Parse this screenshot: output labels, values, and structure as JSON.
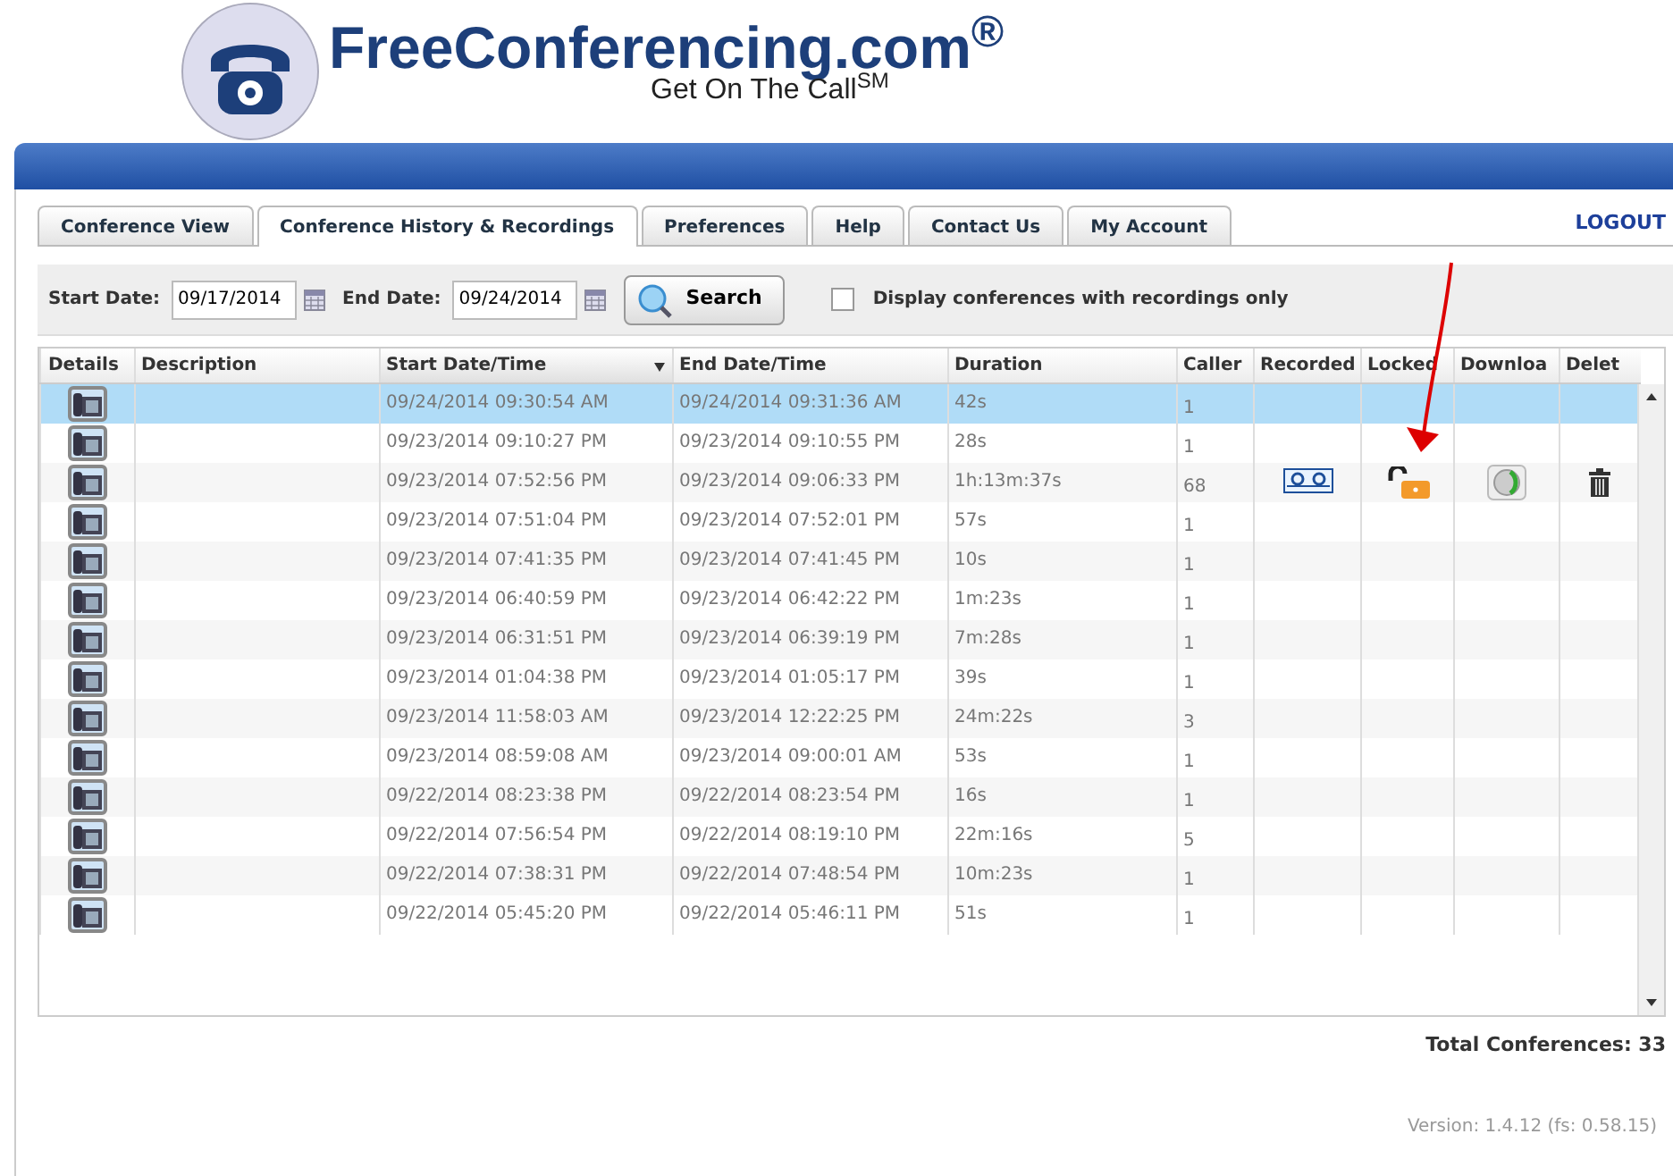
{
  "brand": {
    "name": "FreeConferencing.com$^{®}$",
    "tagline": "Get On The Call$^{SM}$"
  },
  "tabs": [
    {
      "label": "Conference View",
      "selected": false
    },
    {
      "label": "Conference History & Recordings",
      "selected": true
    },
    {
      "label": "Preferences",
      "selected": false
    },
    {
      "label": "Help",
      "selected": false
    },
    {
      "label": "Contact Us",
      "selected": false
    },
    {
      "label": "My Account",
      "selected": false
    }
  ],
  "logout": "LOGOUT",
  "filter": {
    "start_label": "Start Date:",
    "start_value": "09/17/2014",
    "end_label": "End Date:",
    "end_value": "09/24/2014",
    "search_button": "Search",
    "recordings_only": {
      "label": "Display conferences with recordings only",
      "checked": false
    }
  },
  "table": {
    "columns": [
      {
        "label": "Details",
        "sorted": false
      },
      {
        "label": "Description",
        "sorted": false
      },
      {
        "label": "Start Date/Time",
        "sorted": true
      },
      {
        "label": "End Date/Time",
        "sorted": false
      },
      {
        "label": "Duration",
        "sorted": false
      },
      {
        "label": "Caller",
        "sorted": false
      },
      {
        "label": "Recorded",
        "sorted": false
      },
      {
        "label": "Locked",
        "sorted": false
      },
      {
        "label": "Downloa",
        "sorted": false
      },
      {
        "label": "Delet",
        "sorted": false
      }
    ],
    "rows": [
      {
        "selected": true,
        "start": "09/24/2014 09:30:54 AM",
        "end": "09/24/2014 09:31:36 AM",
        "duration": "42s",
        "callers": "1",
        "recording": null
      },
      {
        "selected": false,
        "start": "09/23/2014 09:10:27 PM",
        "end": "09/23/2014 09:10:55 PM",
        "duration": "28s",
        "callers": "1",
        "recording": null
      },
      {
        "selected": false,
        "start": "09/23/2014 07:52:56 PM",
        "end": "09/23/2014 09:06:33 PM",
        "duration": "1h:13m:37s",
        "callers": "68",
        "recording": {
          "locked": false
        }
      },
      {
        "selected": false,
        "start": "09/23/2014 07:51:04 PM",
        "end": "09/23/2014 07:52:01 PM",
        "duration": "57s",
        "callers": "1",
        "recording": null
      },
      {
        "selected": false,
        "start": "09/23/2014 07:41:35 PM",
        "end": "09/23/2014 07:41:45 PM",
        "duration": "10s",
        "callers": "1",
        "recording": null
      },
      {
        "selected": false,
        "start": "09/23/2014 06:40:59 PM",
        "end": "09/23/2014 06:42:22 PM",
        "duration": "1m:23s",
        "callers": "1",
        "recording": null
      },
      {
        "selected": false,
        "start": "09/23/2014 06:31:51 PM",
        "end": "09/23/2014 06:39:19 PM",
        "duration": "7m:28s",
        "callers": "1",
        "recording": null
      },
      {
        "selected": false,
        "start": "09/23/2014 01:04:38 PM",
        "end": "09/23/2014 01:05:17 PM",
        "duration": "39s",
        "callers": "1",
        "recording": null
      },
      {
        "selected": false,
        "start": "09/23/2014 11:58:03 AM",
        "end": "09/23/2014 12:22:25 PM",
        "duration": "24m:22s",
        "callers": "3",
        "recording": null
      },
      {
        "selected": false,
        "start": "09/23/2014 08:59:08 AM",
        "end": "09/23/2014 09:00:01 AM",
        "duration": "53s",
        "callers": "1",
        "recording": null
      },
      {
        "selected": false,
        "start": "09/22/2014 08:23:38 PM",
        "end": "09/22/2014 08:23:54 PM",
        "duration": "16s",
        "callers": "1",
        "recording": null
      },
      {
        "selected": false,
        "start": "09/22/2014 07:56:54 PM",
        "end": "09/22/2014 08:19:10 PM",
        "duration": "22m:16s",
        "callers": "5",
        "recording": null
      },
      {
        "selected": false,
        "start": "09/22/2014 07:38:31 PM",
        "end": "09/22/2014 07:48:54 PM",
        "duration": "10m:23s",
        "callers": "1",
        "recording": null
      },
      {
        "selected": false,
        "start": "09/22/2014 05:45:20 PM",
        "end": "09/22/2014 05:46:11 PM",
        "duration": "51s",
        "callers": "1",
        "recording": null
      }
    ]
  },
  "total": "Total Conferences: 33",
  "version": "Version: 1.4.12 (fs: 0.58.15)"
}
